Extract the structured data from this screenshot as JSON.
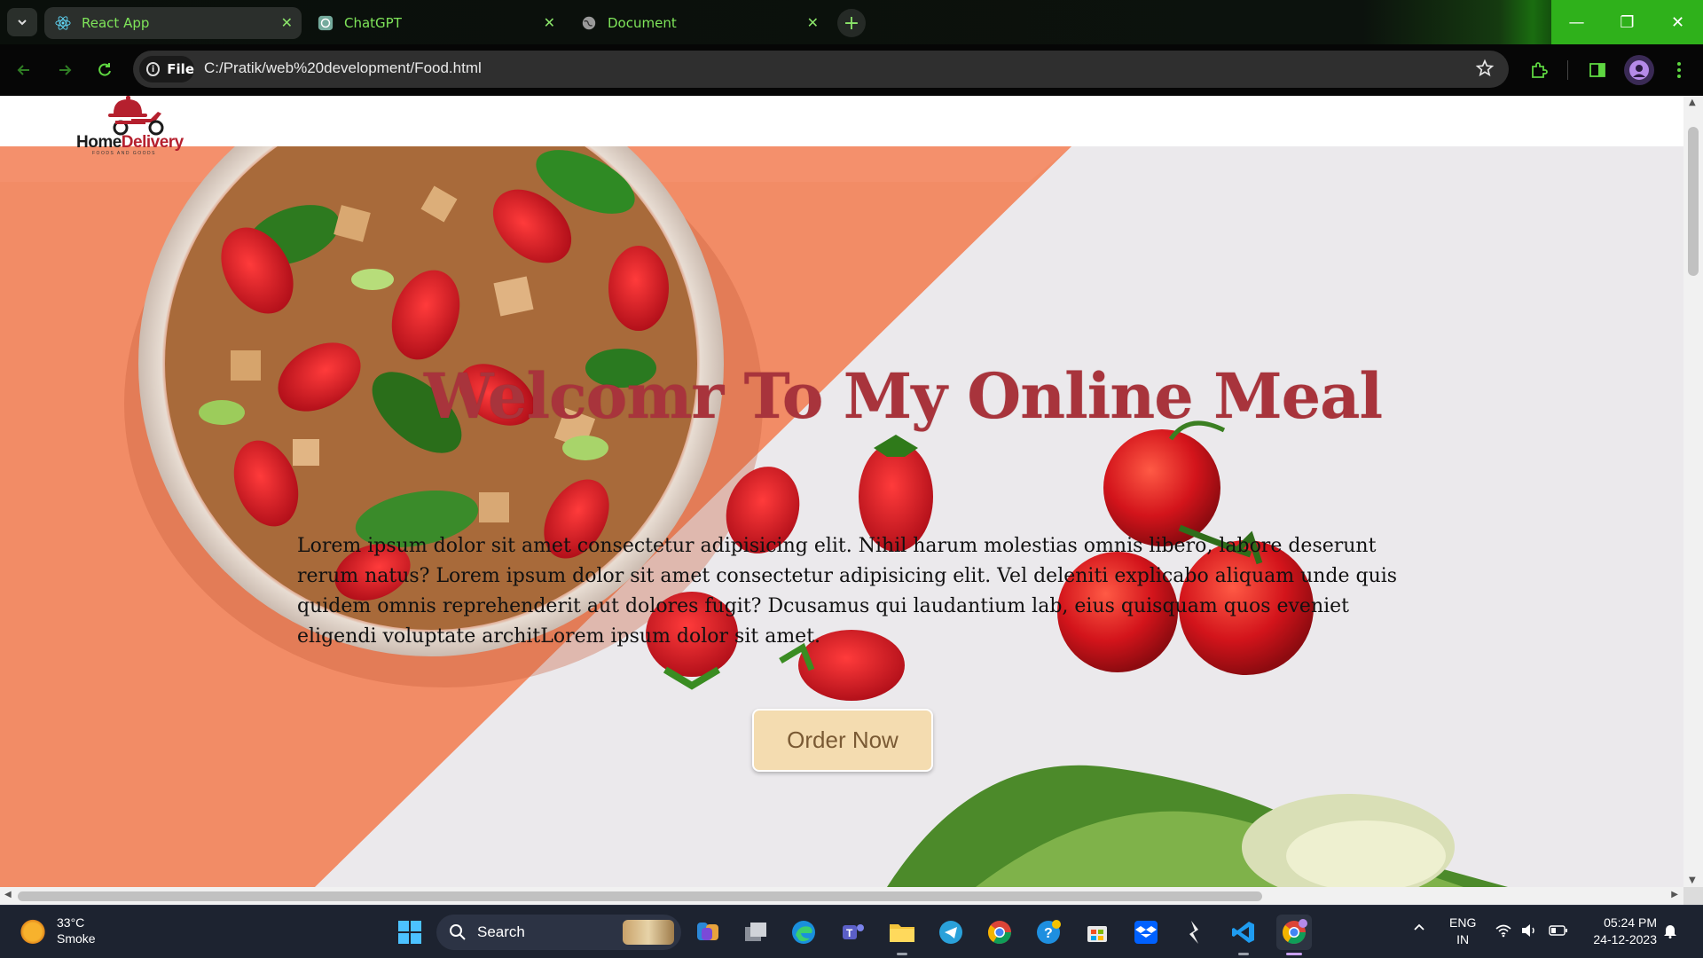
{
  "browser": {
    "tabs": [
      {
        "title": "React App",
        "icon": "react-icon"
      },
      {
        "title": "ChatGPT",
        "icon": "chatgpt-icon"
      },
      {
        "title": "Document",
        "icon": "globe-icon"
      }
    ],
    "site_chip": "File",
    "url": "C:/Pratik/web%20development/Food.html"
  },
  "page": {
    "logo": {
      "home": "Home",
      "delivery": "Delivery",
      "tagline": "FOODS AND GOODS"
    },
    "hero": {
      "title": "Welcomr To My Online Meal",
      "text": "Lorem ipsum dolor sit amet consectetur adipisicing elit. Nihil harum molestias omnis libero, labore deserunt rerum natus? Lorem ipsum dolor sit amet consectetur adipisicing elit. Vel deleniti explicabo aliquam unde quis quidem omnis reprehenderit aut dolores fugit? Dcusamus qui laudantium lab, eius quisquam quos eveniet eligendi voluptate architLorem ipsum dolor sit amet.",
      "button": "Order Now"
    }
  },
  "taskbar": {
    "weather": {
      "temp": "33°C",
      "condition": "Smoke"
    },
    "search": "Search",
    "language": {
      "lang": "ENG",
      "region": "IN"
    },
    "clock": {
      "time": "05:24 PM",
      "date": "24-12-2023"
    }
  },
  "colors": {
    "accent_green": "#2fb11b",
    "title_red": "#a8343c",
    "button_bg": "#f4dcb0",
    "hero_orange": "#f08a67"
  }
}
